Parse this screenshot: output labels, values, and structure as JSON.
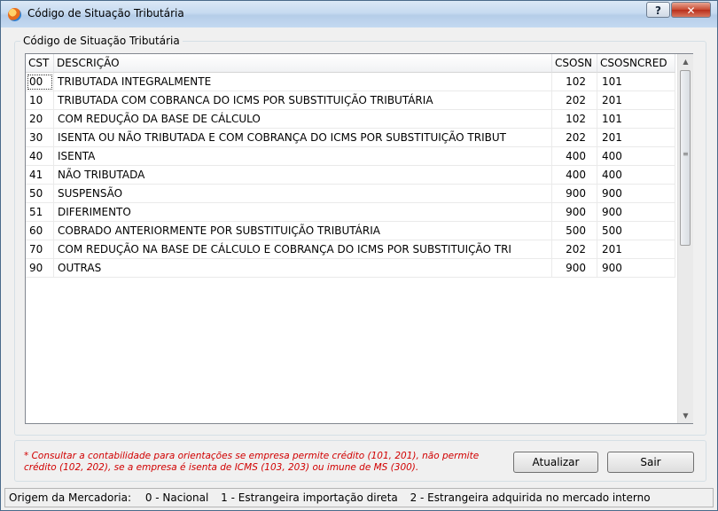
{
  "window": {
    "title": "Código de Situação Tributária",
    "help_label": "?",
    "close_label": "✕"
  },
  "group": {
    "title": "Código de Situação Tributária"
  },
  "table": {
    "headers": [
      "CST",
      "DESCRIÇÃO",
      "CSOSN",
      "CSOSNCRED"
    ],
    "rows": [
      [
        "00",
        "TRIBUTADA INTEGRALMENTE",
        "102",
        "101"
      ],
      [
        "10",
        "TRIBUTADA COM COBRANCA DO ICMS POR SUBSTITUIÇÃO TRIBUTÁRIA",
        "202",
        "201"
      ],
      [
        "20",
        "COM REDUÇÃO DA BASE DE CÁLCULO",
        "102",
        "101"
      ],
      [
        "30",
        "ISENTA OU NÃO TRIBUTADA E COM COBRANÇA DO ICMS POR SUBSTITUIÇÃO TRIBUT",
        "202",
        "201"
      ],
      [
        "40",
        "ISENTA",
        "400",
        "400"
      ],
      [
        "41",
        "NÃO TRIBUTADA",
        "400",
        "400"
      ],
      [
        "50",
        "SUSPENSÃO",
        "900",
        "900"
      ],
      [
        "51",
        "DIFERIMENTO",
        "900",
        "900"
      ],
      [
        "60",
        "COBRADO ANTERIORMENTE POR SUBSTITUIÇÃO TRIBUTÁRIA",
        "500",
        "500"
      ],
      [
        "70",
        "COM REDUÇÃO NA BASE DE CÁLCULO E COBRANÇA DO ICMS POR SUBSTITUIÇÃO TRI",
        "202",
        "201"
      ],
      [
        "90",
        "OUTRAS",
        "900",
        "900"
      ]
    ]
  },
  "scrollbar": {
    "up": "▲",
    "down": "▼",
    "grip": "≡"
  },
  "note": "* Consultar a contabilidade para orientações se empresa permite crédito (101, 201), não permite crédito (102, 202), se a empresa é isenta de ICMS (103, 203) ou imune de MS (300).",
  "buttons": {
    "atualizar": "Atualizar",
    "sair": "Sair"
  },
  "status": {
    "label": "Origem da Mercadoria:",
    "items": [
      "0 - Nacional",
      "1 - Estrangeira importação direta",
      "2 - Estrangeira adquirida no mercado interno"
    ]
  }
}
